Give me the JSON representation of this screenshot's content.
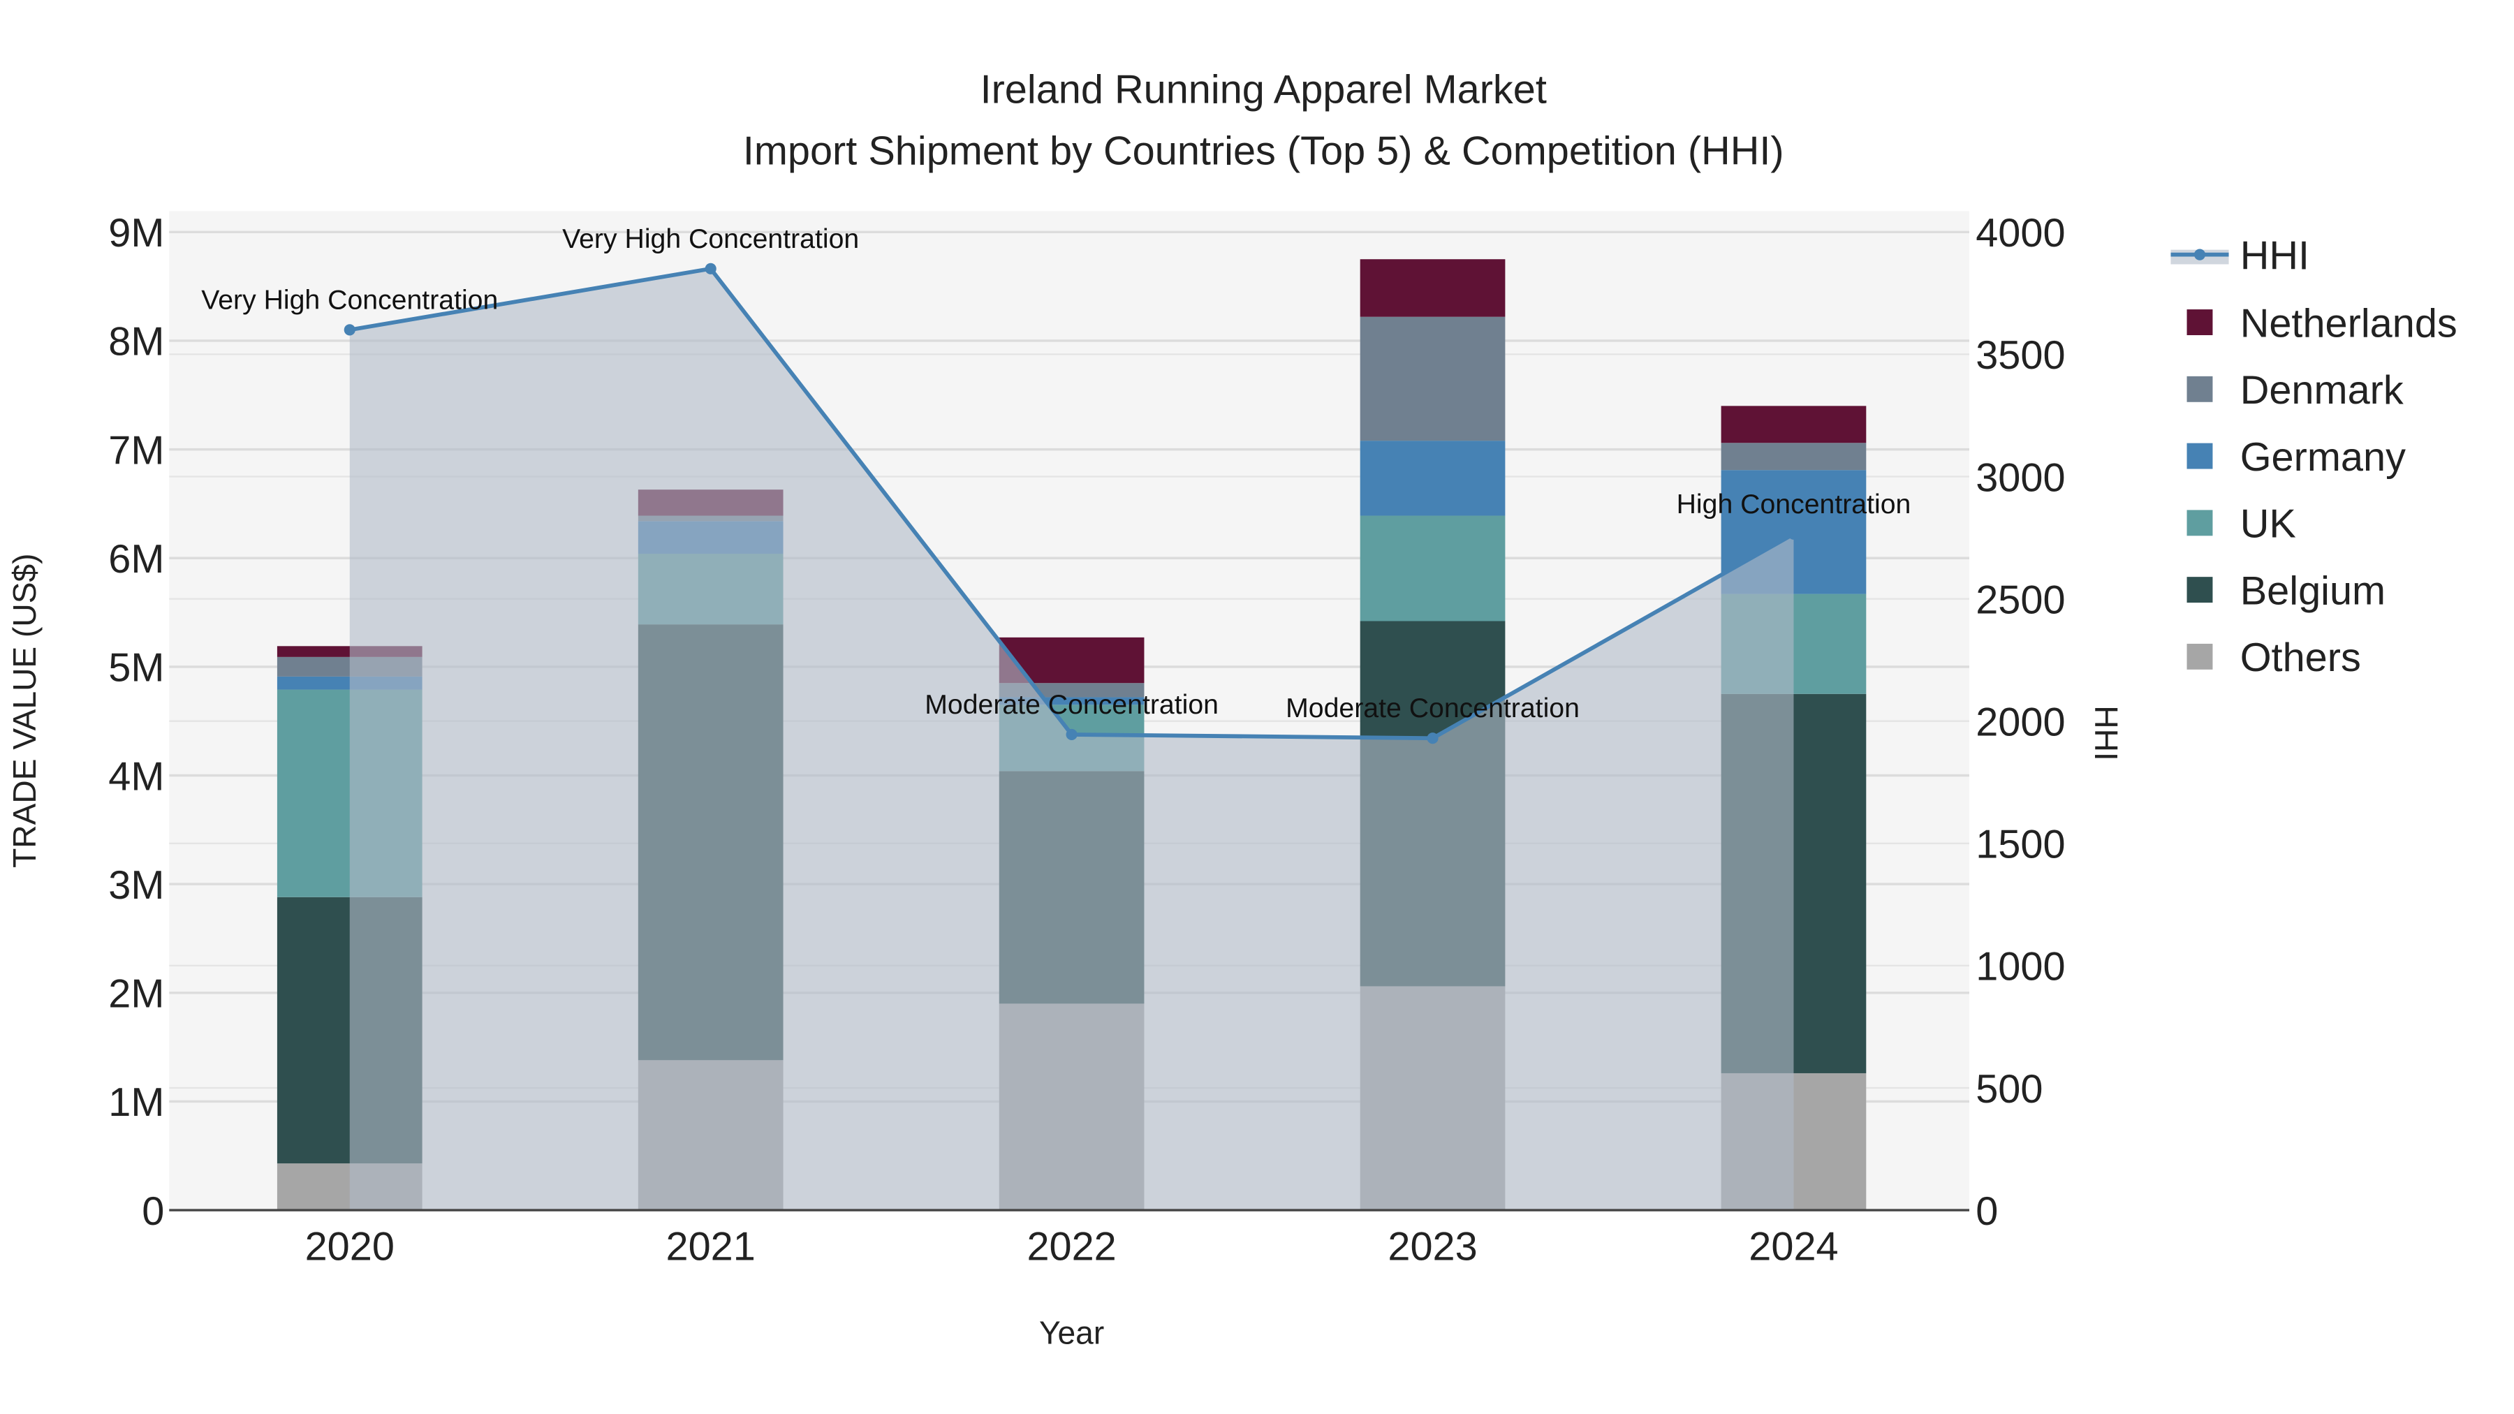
{
  "chart_data": {
    "type": "bar",
    "title": "Ireland Running Apparel Market",
    "subtitle": "Import Shipment by Countries (Top 5) & Competition (HHI)",
    "xlabel": "Year",
    "ylabel": "TRADE VALUE (US$)",
    "y2label": "HHI",
    "categories": [
      "2020",
      "2021",
      "2022",
      "2023",
      "2024"
    ],
    "ylim": [
      0,
      9000000
    ],
    "y2lim": [
      0,
      4000
    ],
    "yticks": [
      {
        "v": 0,
        "label": "0"
      },
      {
        "v": 1000000,
        "label": "1M"
      },
      {
        "v": 2000000,
        "label": "2M"
      },
      {
        "v": 3000000,
        "label": "3M"
      },
      {
        "v": 4000000,
        "label": "4M"
      },
      {
        "v": 5000000,
        "label": "5M"
      },
      {
        "v": 6000000,
        "label": "6M"
      },
      {
        "v": 7000000,
        "label": "7M"
      },
      {
        "v": 8000000,
        "label": "8M"
      },
      {
        "v": 9000000,
        "label": "9M"
      }
    ],
    "y2ticks": [
      {
        "v": 0,
        "label": "0"
      },
      {
        "v": 500,
        "label": "500"
      },
      {
        "v": 1000,
        "label": "1000"
      },
      {
        "v": 1500,
        "label": "1500"
      },
      {
        "v": 2000,
        "label": "2000"
      },
      {
        "v": 2500,
        "label": "2500"
      },
      {
        "v": 3000,
        "label": "3000"
      },
      {
        "v": 3500,
        "label": "3500"
      },
      {
        "v": 4000,
        "label": "4000"
      }
    ],
    "series": [
      {
        "name": "Others",
        "color": "#a6a6a6",
        "values": [
          430000,
          1380000,
          1900000,
          2060000,
          1260000
        ]
      },
      {
        "name": "Belgium",
        "color": "#2f4f4f",
        "values": [
          2450000,
          4010000,
          2140000,
          3360000,
          3490000
        ]
      },
      {
        "name": "UK",
        "color": "#5f9ea0",
        "values": [
          1910000,
          650000,
          610000,
          970000,
          920000
        ]
      },
      {
        "name": "Germany",
        "color": "#4682b4",
        "values": [
          120000,
          300000,
          70000,
          690000,
          1140000
        ]
      },
      {
        "name": "Denmark",
        "color": "#708090",
        "values": [
          180000,
          50000,
          130000,
          1140000,
          250000
        ]
      },
      {
        "name": "Netherlands",
        "color": "#5f1235",
        "values": [
          100000,
          240000,
          420000,
          530000,
          340000
        ]
      }
    ],
    "hhi": {
      "name": "HHI",
      "color": "#4682b4",
      "values": [
        3600,
        3850,
        1945,
        1930,
        2765
      ],
      "annotations": [
        "Very High Concentration",
        "Very High Concentration",
        "Moderate Concentration",
        "Moderate Concentration",
        "High Concentration"
      ]
    },
    "legend_position": "right"
  }
}
